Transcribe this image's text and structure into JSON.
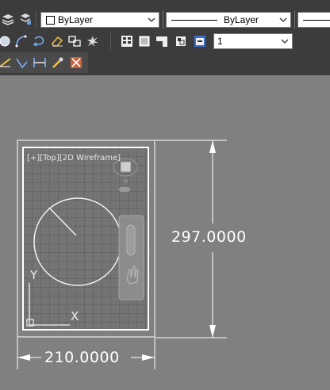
{
  "toolbar": {
    "color_dropdown": {
      "value": "ByLayer"
    },
    "linetype_dropdown": {
      "value": "ByLayer"
    },
    "lineweight_dropdown": {
      "value": "1"
    },
    "icons_row1": [
      "layer-states-icon",
      "layer-match-icon"
    ],
    "icons_row2": [
      "circle-icon",
      "arc-icon",
      "rotate-icon",
      "eraser-icon",
      "copy-icon",
      "explode-icon"
    ],
    "icons_row2b": [
      "plot-icon",
      "layout-icon",
      "draw-order-icon",
      "text-icon",
      "viewport-icon"
    ],
    "icons_row3": [
      "measure-icon",
      "linear-dim-icon",
      "aligned-dim-icon",
      "quick-dim-icon",
      "erase-dim-icon"
    ]
  },
  "viewport": {
    "label": "[+][Top][2D Wireframe]",
    "ucs": {
      "y_label": "Y",
      "x_label": "X"
    }
  },
  "dimensions": {
    "vertical": "297.0000",
    "horizontal": "210.0000"
  },
  "colors": {
    "toolbar_bg": "#3c3c3c",
    "canvas_bg": "#808080",
    "sheet_grid": "#5c5c5c",
    "lines": "#ffffff"
  }
}
